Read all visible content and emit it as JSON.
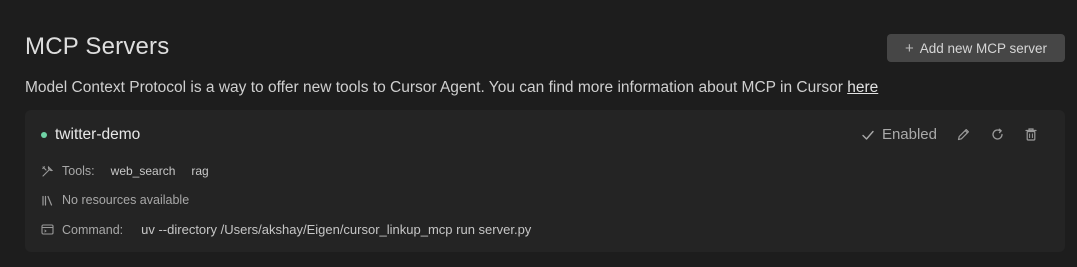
{
  "page": {
    "title": "MCP Servers",
    "add_button_label": "Add new MCP server",
    "description": "Model Context Protocol is a way to offer new tools to Cursor Agent. You can find more information about MCP in Cursor ",
    "description_link": "here"
  },
  "server": {
    "name": "twitter-demo",
    "status_color": "#6fd3a5",
    "enabled_label": "Enabled",
    "tools_label": "Tools:",
    "tools": [
      "web_search",
      "rag"
    ],
    "resources_label": "No resources available",
    "command_label": "Command:",
    "command_value": "uv --directory /Users/akshay/Eigen/cursor_linkup_mcp run server.py"
  },
  "icons": {
    "add": "plus-icon",
    "enabled": "checkmark-icon",
    "edit": "pencil-icon",
    "refresh": "refresh-icon",
    "delete": "trash-icon",
    "tools": "tools-icon",
    "resources": "resources-icon",
    "command": "terminal-icon"
  }
}
